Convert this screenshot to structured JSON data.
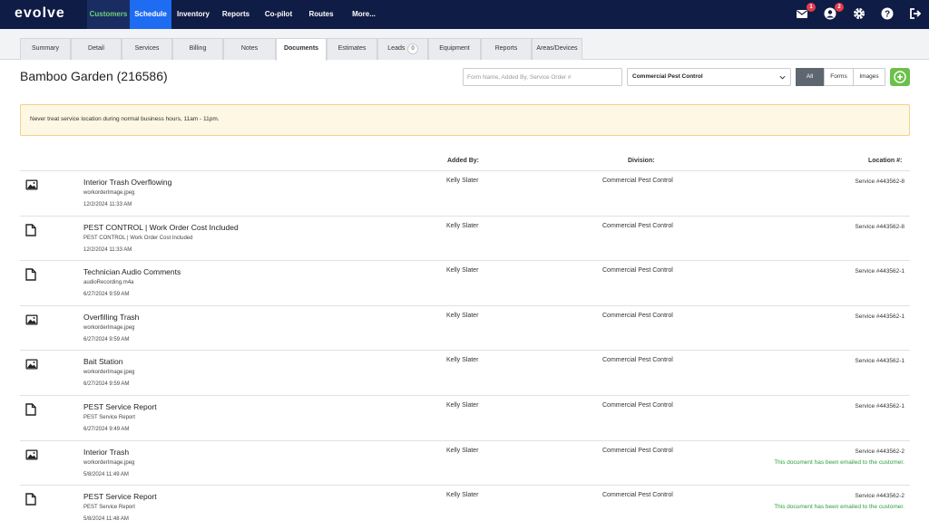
{
  "app": {
    "logo": "evolve"
  },
  "nav": [
    {
      "label": "Customers"
    },
    {
      "label": "Schedule"
    },
    {
      "label": "Inventory"
    },
    {
      "label": "Reports"
    },
    {
      "label": "Co-pilot"
    },
    {
      "label": "Routes"
    },
    {
      "label": "More..."
    }
  ],
  "nav_icons": {
    "mail_badge": "1",
    "user_badge": "2"
  },
  "tabs": [
    {
      "label": "Summary"
    },
    {
      "label": "Detail"
    },
    {
      "label": "Services"
    },
    {
      "label": "Billing"
    },
    {
      "label": "Notes"
    },
    {
      "label": "Documents"
    },
    {
      "label": "Estimates"
    },
    {
      "label": "Leads",
      "count": "0"
    },
    {
      "label": "Equipment"
    },
    {
      "label": "Reports"
    },
    {
      "label": "Areas/Devices"
    }
  ],
  "header": {
    "title": "Bamboo Garden (216586)",
    "search_placeholder": "Form Name, Added By, Service Order #",
    "division": "Commercial Pest Control",
    "filters": [
      "All",
      "Forms",
      "Images"
    ]
  },
  "notice": "Never treat service location during normal business hours, 11am - 11pm.",
  "columns": {
    "added_by": "Added By:",
    "division": "Division:",
    "location": "Location #:"
  },
  "documents": [
    {
      "icon": "image-icon",
      "name": "Interior Trash Overflowing",
      "file": "workorderImage.jpeg",
      "date": "12/2/2024 11:33 AM",
      "added_by": "Kelly Slater",
      "division": "Commercial Pest Control",
      "location": "Service #443562-8",
      "emailed": ""
    },
    {
      "icon": "document-icon",
      "name": "PEST CONTROL | Work Order Cost Included",
      "file": "PEST CONTROL | Work Order Cost Included",
      "date": "12/2/2024 11:33 AM",
      "added_by": "Kelly Slater",
      "division": "Commercial Pest Control",
      "location": "Service #443562-8",
      "emailed": ""
    },
    {
      "icon": "document-icon",
      "name": "Technician Audio Comments",
      "file": "audioRecording.m4a",
      "date": "6/27/2024 9:59 AM",
      "added_by": "Kelly Slater",
      "division": "Commercial Pest Control",
      "location": "Service #443562-1",
      "emailed": ""
    },
    {
      "icon": "image-icon",
      "name": "Overfilling Trash",
      "file": "workorderImage.jpeg",
      "date": "6/27/2024 9:59 AM",
      "added_by": "Kelly Slater",
      "division": "Commercial Pest Control",
      "location": "Service #443562-1",
      "emailed": ""
    },
    {
      "icon": "image-icon",
      "name": "Bait Station",
      "file": "workorderImage.jpeg",
      "date": "6/27/2024 9:59 AM",
      "added_by": "Kelly Slater",
      "division": "Commercial Pest Control",
      "location": "Service #443562-1",
      "emailed": ""
    },
    {
      "icon": "document-icon",
      "name": "PEST Service Report",
      "file": "PEST Service Report",
      "date": "6/27/2024 9:49 AM",
      "added_by": "Kelly Slater",
      "division": "Commercial Pest Control",
      "location": "Service #443562-1",
      "emailed": ""
    },
    {
      "icon": "image-icon",
      "name": "Interior Trash",
      "file": "workorderImage.jpeg",
      "date": "5/8/2024 11:49 AM",
      "added_by": "Kelly Slater",
      "division": "Commercial Pest Control",
      "location": "Service #443562-2",
      "emailed": "This document has been emailed to the customer."
    },
    {
      "icon": "document-icon",
      "name": "PEST Service Report",
      "file": "PEST Service Report",
      "date": "5/8/2024 11:48 AM",
      "added_by": "Kelly Slater",
      "division": "Commercial Pest Control",
      "location": "Service #443562-2",
      "emailed": "This document has been emailed to the customer."
    }
  ]
}
